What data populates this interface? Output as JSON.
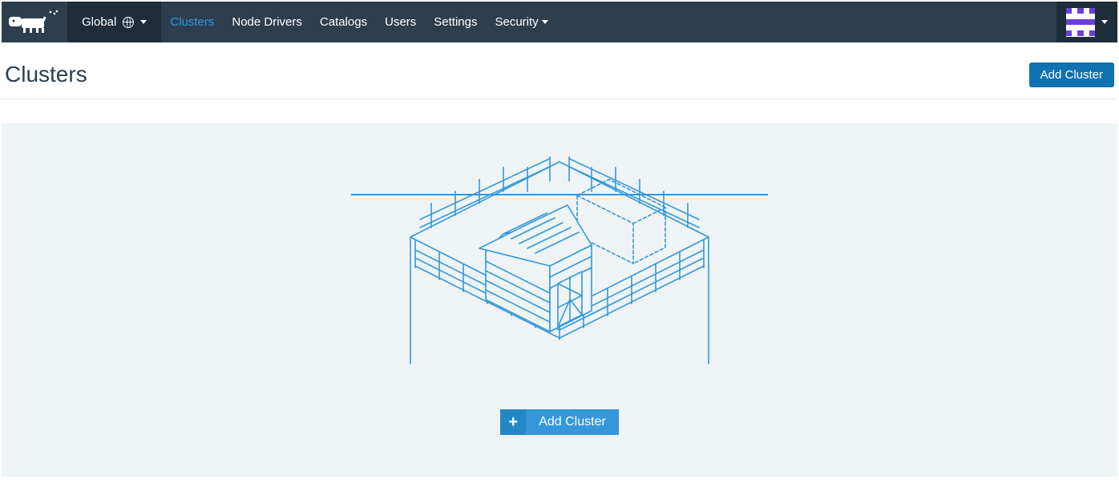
{
  "nav": {
    "scope_label": "Global",
    "items": [
      {
        "label": "Clusters",
        "active": true,
        "has_caret": false
      },
      {
        "label": "Node Drivers",
        "active": false,
        "has_caret": false
      },
      {
        "label": "Catalogs",
        "active": false,
        "has_caret": false
      },
      {
        "label": "Users",
        "active": false,
        "has_caret": false
      },
      {
        "label": "Settings",
        "active": false,
        "has_caret": false
      },
      {
        "label": "Security",
        "active": false,
        "has_caret": true
      }
    ]
  },
  "page": {
    "title": "Clusters",
    "add_button_label": "Add Cluster"
  },
  "empty_state": {
    "cta_label": "Add Cluster"
  },
  "colors": {
    "primary": "#3497da",
    "primary_dark": "#1072b0",
    "navbar_bg": "#2d3e4f",
    "navbar_dark": "#1f2d3a",
    "panel_bg": "#eef4f5",
    "avatar_accent": "#6a3fe0"
  }
}
